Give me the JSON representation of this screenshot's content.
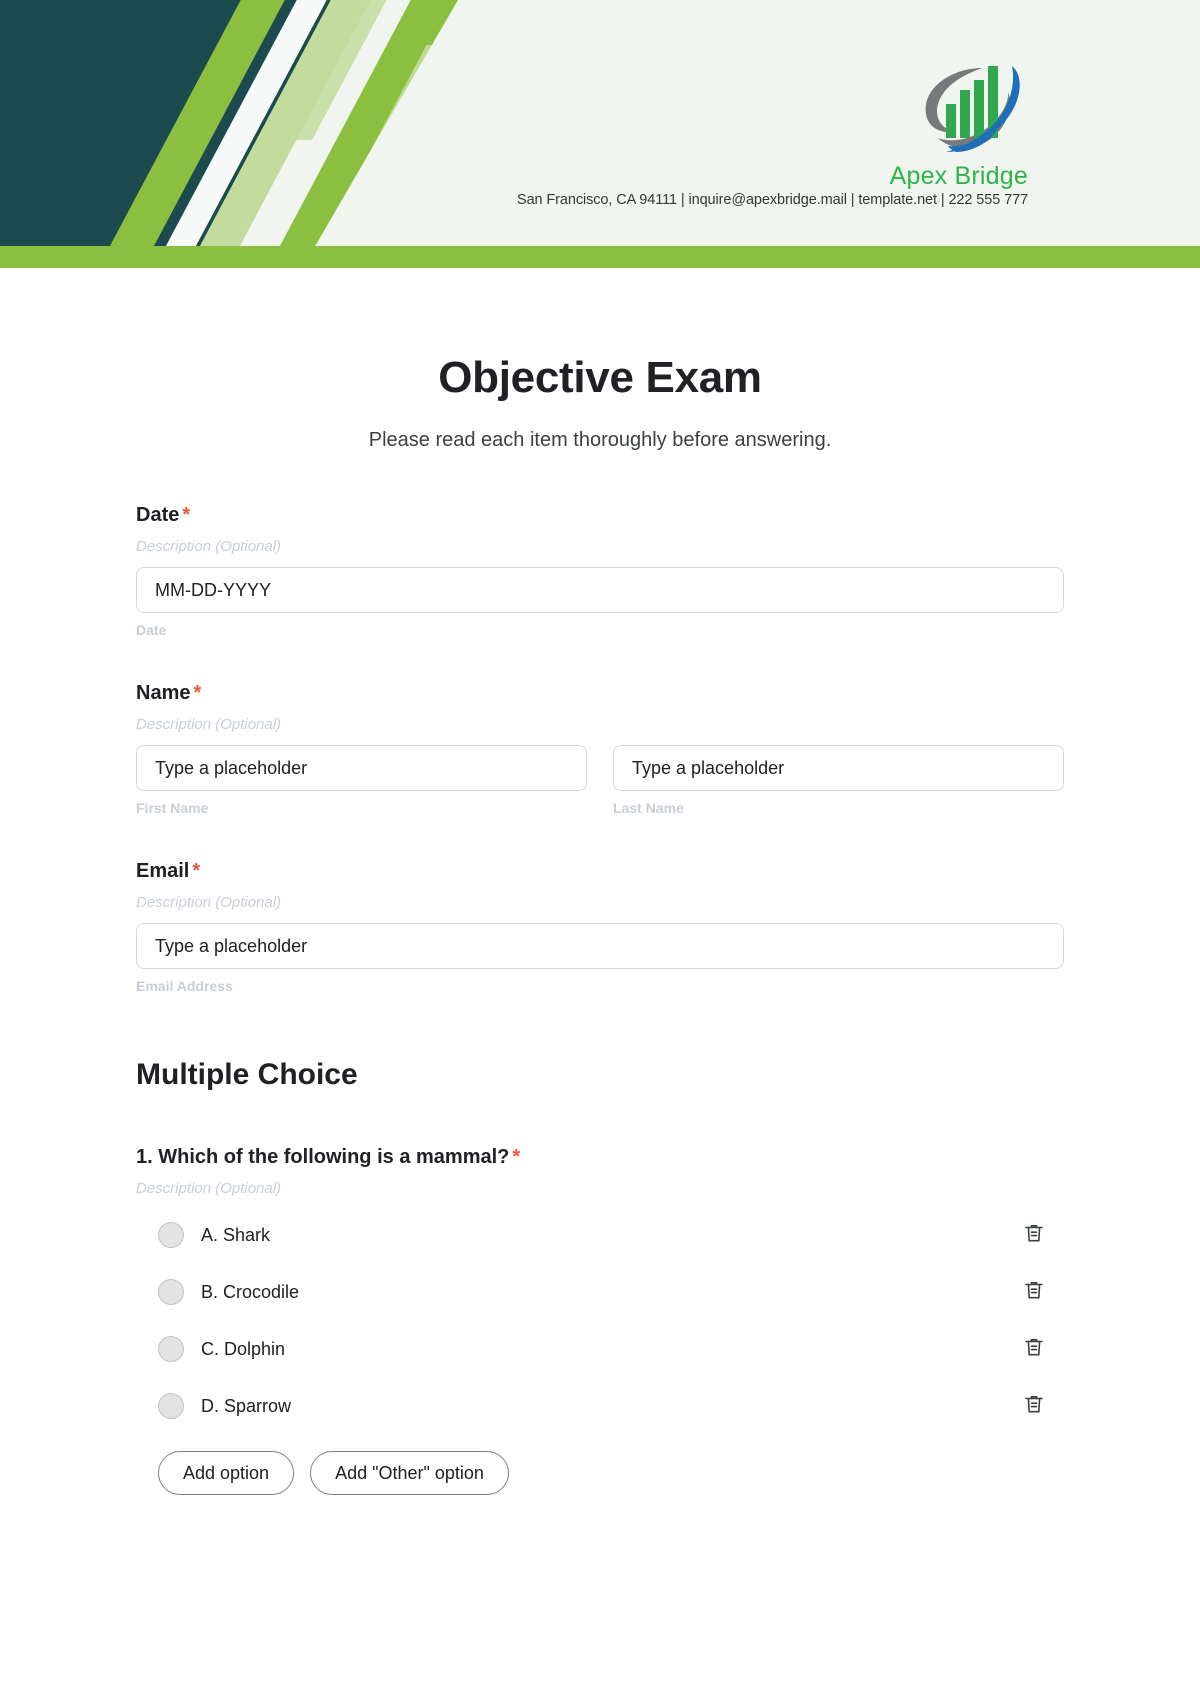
{
  "header": {
    "brand": "Apex Bridge",
    "contact": "San Francisco, CA 94111 | inquire@apexbridge.mail | template.net | 222 555 777",
    "colors": {
      "teal": "#1D4A4E",
      "green": "#8CBF3F",
      "light_green": "#C3DC9D",
      "mint_bg": "#F0F6EF",
      "brand_text": "#30B34B",
      "logo_bar_green": "#2FA84F",
      "logo_swoosh_blue": "#1C6FB8",
      "logo_swoosh_gray": "#77797B"
    }
  },
  "form": {
    "title": "Objective Exam",
    "subtitle": "Please read each item thoroughly before answering.",
    "required_marker": "*",
    "fields": [
      {
        "label": "Date",
        "required": true,
        "description": "Description (Optional)",
        "inputs": [
          {
            "value": "MM-DD-YYYY",
            "help": "Date"
          }
        ]
      },
      {
        "label": "Name",
        "required": true,
        "description": "Description (Optional)",
        "inputs": [
          {
            "value": "Type a placeholder",
            "help": "First Name"
          },
          {
            "value": "Type a placeholder",
            "help": "Last Name"
          }
        ]
      },
      {
        "label": "Email",
        "required": true,
        "description": "Description (Optional)",
        "inputs": [
          {
            "value": "Type a placeholder",
            "help": "Email Address"
          }
        ]
      }
    ],
    "section": {
      "title": "Multiple Choice",
      "question": {
        "label": "1. Which of the following is a mammal?",
        "required": true,
        "description": "Description (Optional)",
        "options": [
          {
            "text": "A. Shark"
          },
          {
            "text": "B. Crocodile"
          },
          {
            "text": "C. Dolphin"
          },
          {
            "text": "D. Sparrow"
          }
        ],
        "buttons": [
          {
            "label": "Add option"
          },
          {
            "label": "Add \"Other\" option"
          }
        ]
      }
    }
  }
}
